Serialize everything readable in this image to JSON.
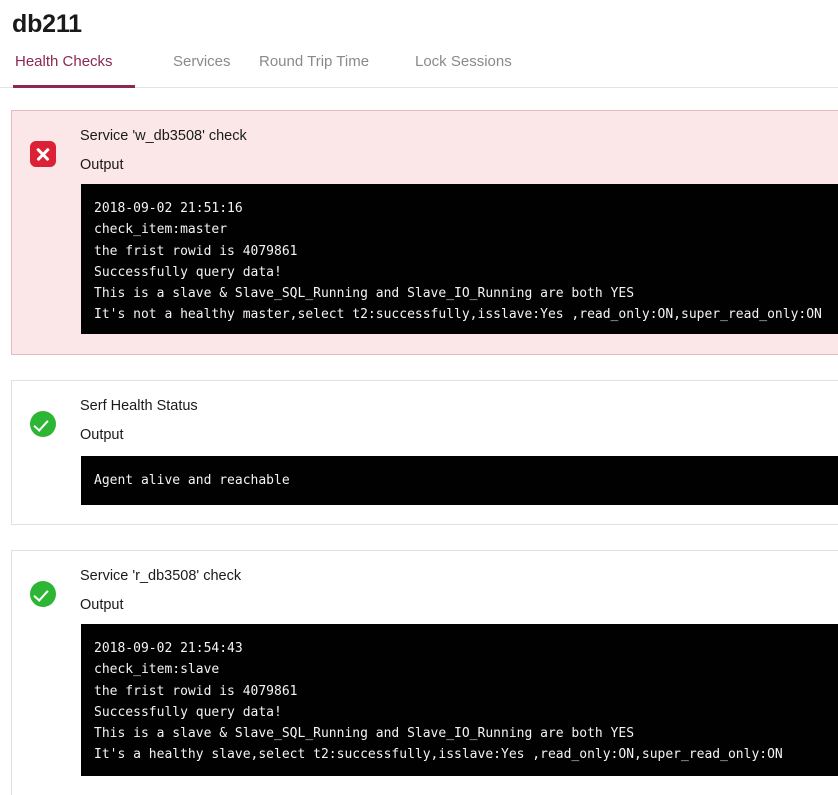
{
  "header": {
    "title": "db211"
  },
  "tabs": [
    {
      "label": "Health Checks",
      "active": true,
      "name": "tab-health-checks"
    },
    {
      "label": "Services",
      "active": false,
      "name": "tab-services"
    },
    {
      "label": "Round Trip Time",
      "active": false,
      "name": "tab-round-trip-time"
    },
    {
      "label": "Lock Sessions",
      "active": false,
      "name": "tab-lock-sessions"
    }
  ],
  "colors": {
    "accent": "#8c2751",
    "critical_bg": "#fbe6e8",
    "critical_border": "#e9b9c0",
    "critical_icon": "#dc2036",
    "passing_icon": "#2cb634",
    "terminal_bg": "#010101",
    "terminal_fg": "#f4f4f4"
  },
  "output_label": "Output",
  "checks": [
    {
      "name": "Service 'w_db3508' check",
      "status": "critical",
      "status_icon": "x-circle-icon",
      "output_label": "Output",
      "output": "2018-09-02 21:51:16\ncheck_item:master\nthe frist rowid is 4079861\nSuccessfully query data!\nThis is a slave & Slave_SQL_Running and Slave_IO_Running are both YES\nIt's not a healthy master,select t2:successfully,isslave:Yes ,read_only:ON,super_read_only:ON"
    },
    {
      "name": "Serf Health Status",
      "status": "passing",
      "status_icon": "check-circle-icon",
      "output_label": "Output",
      "output": "Agent alive and reachable"
    },
    {
      "name": "Service 'r_db3508' check",
      "status": "passing",
      "status_icon": "check-circle-icon",
      "output_label": "Output",
      "output": "2018-09-02 21:54:43\ncheck_item:slave\nthe frist rowid is 4079861\nSuccessfully query data!\nThis is a slave & Slave_SQL_Running and Slave_IO_Running are both YES\nIt's a healthy slave,select t2:successfully,isslave:Yes ,read_only:ON,super_read_only:ON"
    }
  ]
}
